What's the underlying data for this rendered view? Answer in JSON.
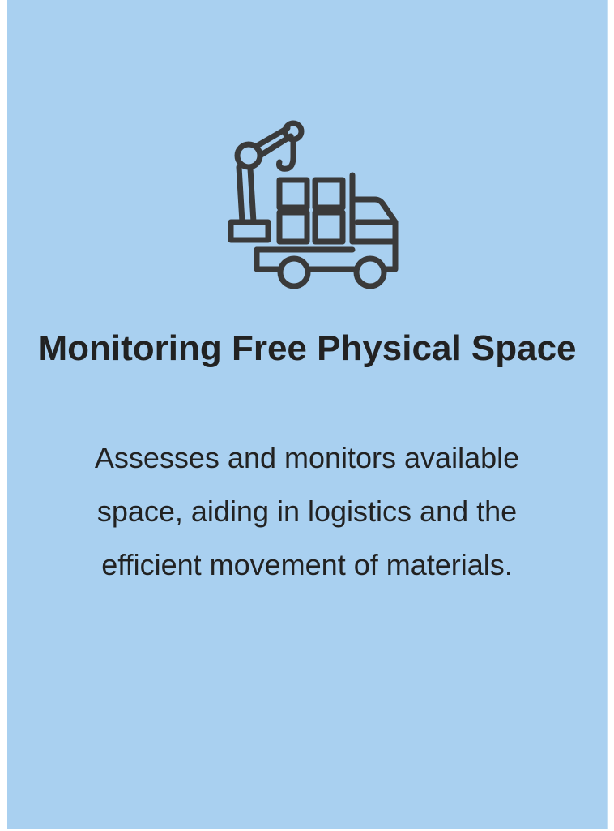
{
  "card": {
    "background_color": "#a9d0f0",
    "icon": "truck-with-crane-icon",
    "title": "Monitoring Free Physical Space",
    "description": "Assesses and monitors available space, aiding in logistics and the efficient movement of materials."
  }
}
